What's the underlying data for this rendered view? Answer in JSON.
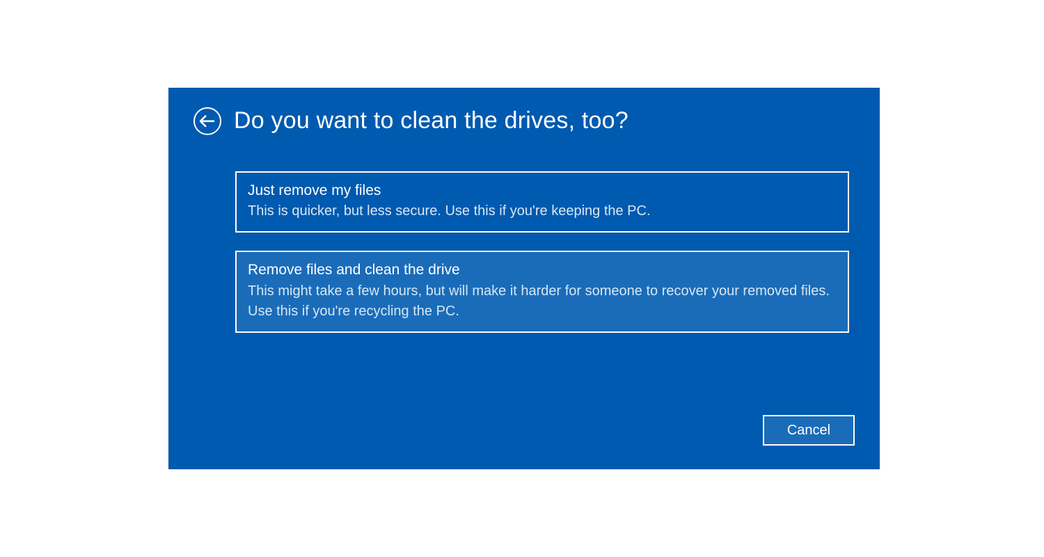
{
  "header": {
    "title": "Do you want to clean the drives, too?"
  },
  "options": [
    {
      "title": "Just remove my files",
      "description": "This is quicker, but less secure. Use this if you're keeping the PC.",
      "highlighted": false
    },
    {
      "title": "Remove files and clean the drive",
      "description": "This might take a few hours, but will make it harder for someone to recover your removed files. Use this if you're recycling the PC.",
      "highlighted": true
    }
  ],
  "footer": {
    "cancel_label": "Cancel"
  },
  "colors": {
    "dialog_bg": "#005aaf",
    "highlight_bg": "#1a6cb9",
    "text": "#ffffff",
    "desc_text": "#d6e7f4"
  }
}
